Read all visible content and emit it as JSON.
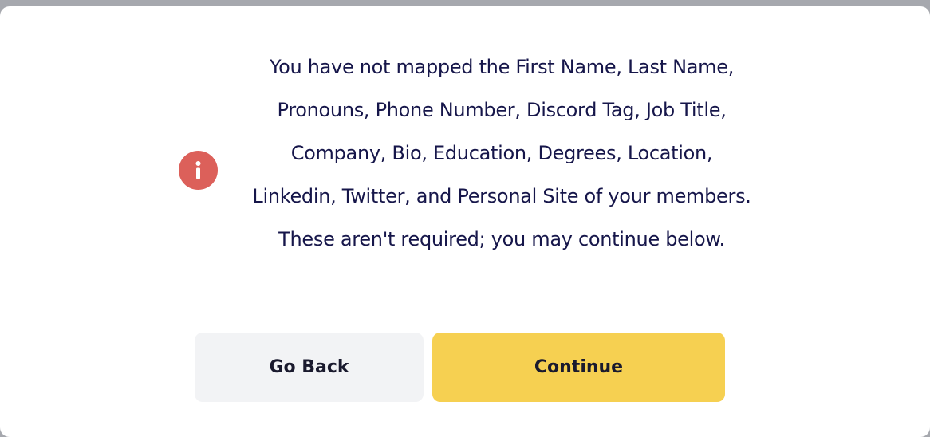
{
  "dialog": {
    "message": "You have not mapped the First Name, Last Name, Pronouns, Phone Number, Discord Tag, Job Title, Company, Bio, Education, Degrees, Location, Linkedin, Twitter, and Personal Site of your members. These aren't required; you may continue below.",
    "icon": "info-alert-icon",
    "buttons": {
      "back_label": "Go Back",
      "continue_label": "Continue"
    }
  },
  "colors": {
    "alert_icon": "#dc605a",
    "text": "#16164a",
    "back_button_bg": "#f2f3f5",
    "continue_button_bg": "#f6d051",
    "backdrop": "#a6a8ae"
  }
}
